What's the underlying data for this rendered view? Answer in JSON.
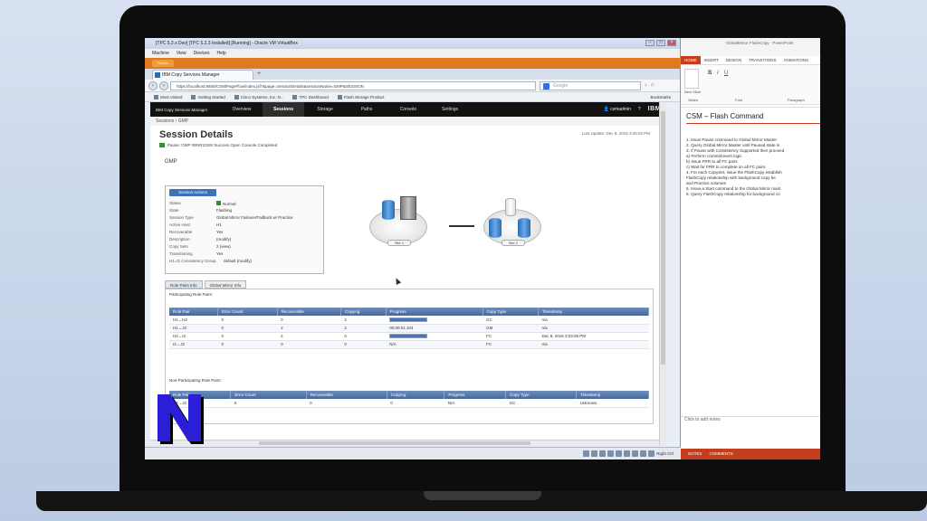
{
  "vbox": {
    "title": "[TPC 5.2.x Dev] [TPC 5.2.3 Installed] [Running] - Oracle VM VirtualBox",
    "menu": [
      "Machine",
      "View",
      "Devices",
      "Help"
    ]
  },
  "firefox": {
    "logo": "Firefox",
    "tab_title": "IBM Copy Services Manager",
    "url": "https://localhost:9559/CSM/PageFlow/index.jsf?&page=SessionDetails&sessionName=GMP&SESSION",
    "search_placeholder": "Google",
    "bookmarks": [
      "Most Visited",
      "Getting Started",
      "Cisco Systems, Inc. N...",
      "TPC Dashboard",
      "Flash Storage Product"
    ],
    "bookmarks_right": "Bookmarks"
  },
  "app": {
    "brand": "IBM Copy Services Manager",
    "nav": [
      "Overview",
      "Sessions",
      "Storage",
      "Paths",
      "Console",
      "Settings"
    ],
    "active_nav": "Sessions",
    "user": "csmadmin",
    "vendor": "IBM",
    "breadcrumb": "Sessions  ›  GMP",
    "page_title": "Session Details",
    "last_update": "Last Update: Dec 8, 2015 3:26:02 PM",
    "status_line": "Pause: GMP   IWNR1029I   Success   Open Console   Completed",
    "session_name": "GMP",
    "actions_button": "Session Actions",
    "properties": [
      {
        "k": "Status",
        "v": "Normal"
      },
      {
        "k": "State",
        "v": "Flashing"
      },
      {
        "k": "Session Type",
        "v": "Global Mirror Failover/Failback w/ Practice"
      },
      {
        "k": "Active Host",
        "v": "H1"
      },
      {
        "k": "Recoverable",
        "v": "Yes"
      },
      {
        "k": "Description",
        "v": "(modify)"
      },
      {
        "k": "Copy Sets",
        "v": "2 (view)"
      },
      {
        "k": "Transitioning",
        "v": "Yes"
      },
      {
        "k": "H1-J2 Consistency Group",
        "v": "default (modify)"
      }
    ],
    "site1": "Site 1",
    "site2": "Site 2",
    "tab_role_pairs": "Role Pairs Info",
    "tab_global_mirror": "Global Mirror Info",
    "participating_label": "Participating Role Pairs:",
    "non_participating_label": "Non-Participating Role Pairs:",
    "columns": [
      "Role Pair",
      "Error Count",
      "Recoverable",
      "Copying",
      "Progress",
      "Copy Type",
      "Timestamp"
    ],
    "participating_rows": [
      {
        "pair": "H1→H2",
        "err": "0",
        "rec": "0",
        "copying": "2",
        "progress": "",
        "progress_pct": 100,
        "type": "GC",
        "ts": "n/a"
      },
      {
        "pair": "H1→J2",
        "err": "0",
        "rec": "2",
        "copying": "2",
        "progress": "00:00:01.104",
        "progress_pct": 0,
        "type": "GM",
        "ts": "n/a"
      },
      {
        "pair": "H2→I2",
        "err": "0",
        "rec": "2",
        "copying": "0",
        "progress": "",
        "progress_pct": 100,
        "type": "FC",
        "ts": "Dec 8, 2015 3:03:08 PM"
      },
      {
        "pair": "I2→J2",
        "err": "0",
        "rec": "0",
        "copying": "0",
        "progress": "N/A",
        "progress_pct": 0,
        "type": "FC",
        "ts": "n/a"
      }
    ],
    "non_participating_rows": [
      {
        "pair": "H2→J2",
        "err": "0",
        "rec": "0",
        "copying": "0",
        "progress": "N/A",
        "progress_pct": 0,
        "type": "GC",
        "ts": "Unknown"
      }
    ]
  },
  "vbox_status": {
    "host_key": "Right Ctrl"
  },
  "ppt": {
    "title": "GlobalMirror FlashCopy - PowerPoint",
    "tabs": [
      "HOME",
      "INSERT",
      "DESIGN",
      "TRANSITIONS",
      "ANIMATIONS"
    ],
    "ribbon_new_slide": "New Slide",
    "ribbon_groups": [
      "Slides",
      "Font",
      "Paragraph"
    ],
    "slide_title": "CSM – Flash Command",
    "slide_lines": [
      "1.  Issue Pause command to Global Mirror Master",
      "2.  Query Global Mirror Master until Paused state is",
      "3.  If Pause with Consistency Supported then proceed",
      "      a)  Perform commit/revert logic",
      "      b)  Issue FRR to all FC pairs",
      "      c)  Wait for FRR to complete on all FC pairs",
      "4.  For each CopySet, issue the FlashCopy establish",
      "      FlashCopy relationship with background copy be",
      "      and Practice volumes",
      "5.  Issue a Start command to the Global Mirror mast",
      "6.  Query FlashCopy relationship for background co"
    ],
    "notes_placeholder": "Click to add notes",
    "status": [
      "NOTES",
      "COMMENTS"
    ]
  },
  "colors": {
    "ppt_accent": "#c43e1c",
    "app_nav_bg": "#121212",
    "table_header": "#46689a",
    "logo_blue": "#2a1fd6"
  }
}
